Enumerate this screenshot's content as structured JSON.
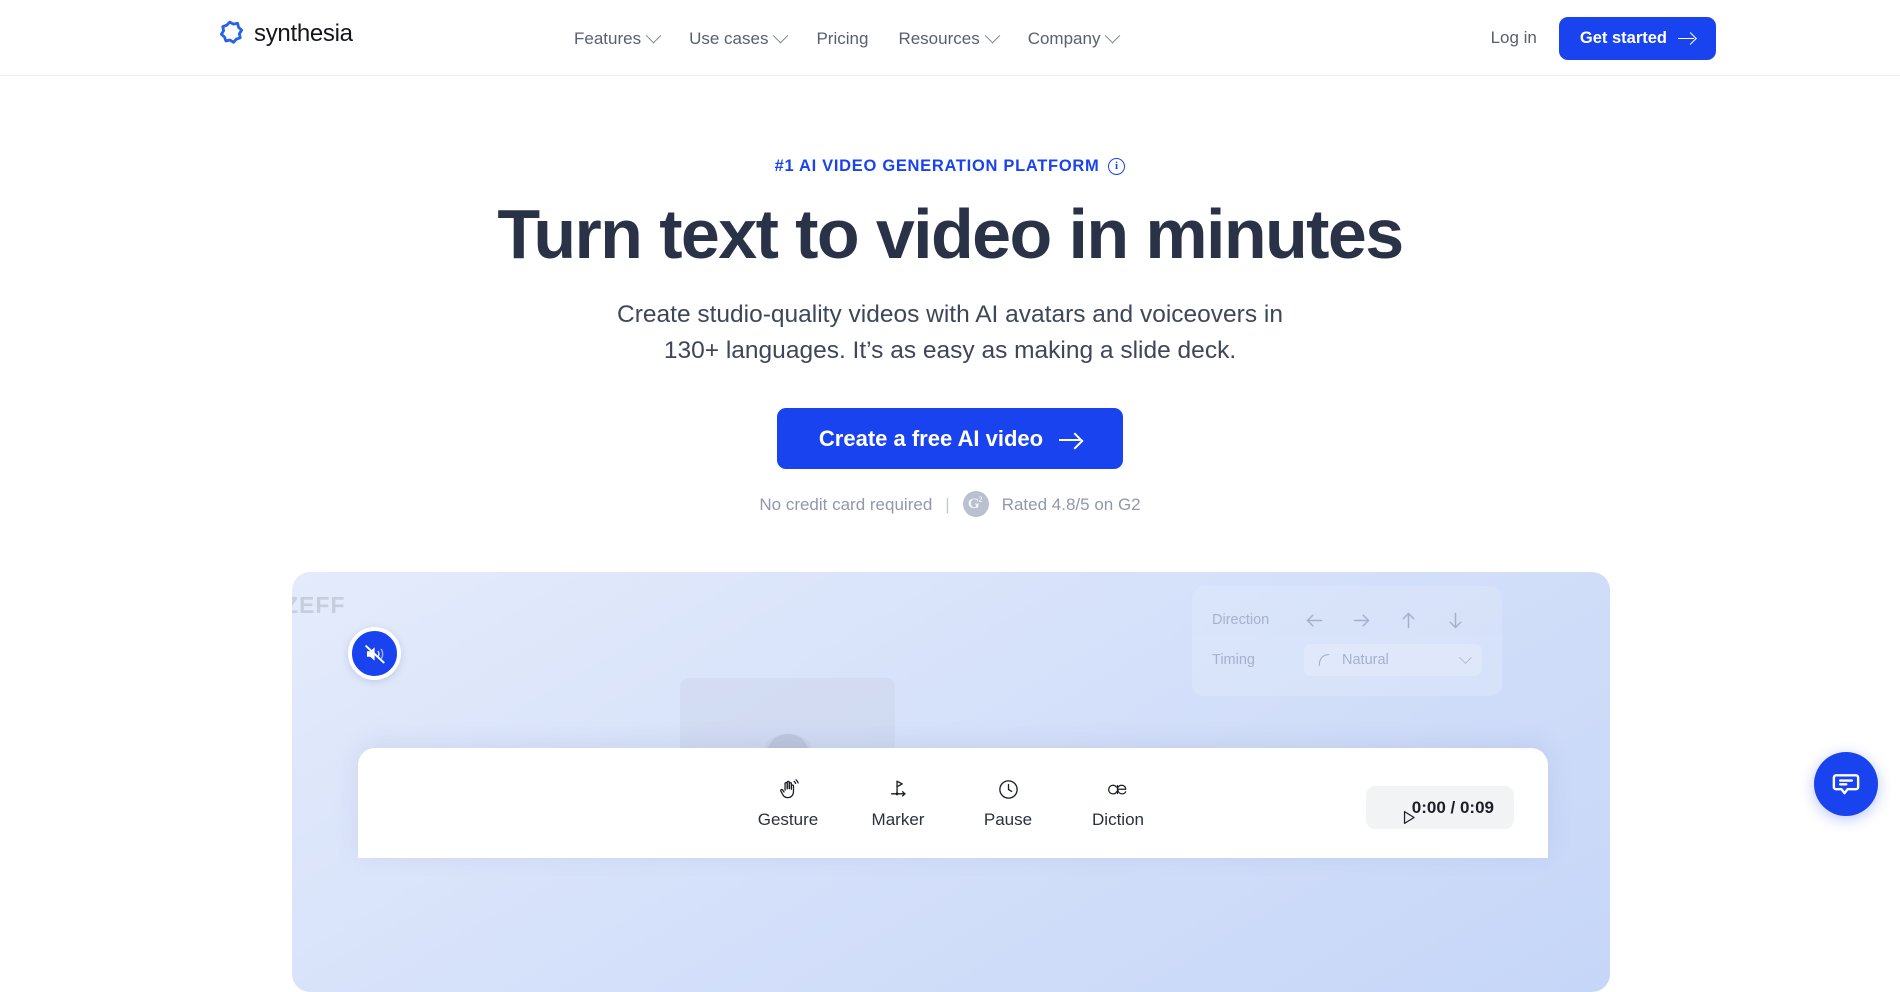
{
  "header": {
    "logo_text": "synthesia",
    "logo_icon": "synthesia-starburst-icon",
    "nav": [
      {
        "label": "Features",
        "has_dropdown": true
      },
      {
        "label": "Use cases",
        "has_dropdown": true
      },
      {
        "label": "Pricing",
        "has_dropdown": false
      },
      {
        "label": "Resources",
        "has_dropdown": true
      },
      {
        "label": "Company",
        "has_dropdown": true
      }
    ],
    "login_label": "Log in",
    "get_started_label": "Get started"
  },
  "hero": {
    "eyebrow": "#1 AI VIDEO GENERATION PLATFORM",
    "eyebrow_info_icon": "info-circle-icon",
    "headline": "Turn text to video in minutes",
    "subhead_line1": "Create studio-quality videos with AI avatars and voiceovers in",
    "subhead_line2": "130+ languages. It’s as easy as making a slide deck.",
    "cta_label": "Create a free AI video",
    "no_credit_card": "No credit card required",
    "separator": "|",
    "g2_mark": "G",
    "g2_sup": "2",
    "rating_text": "Rated 4.8/5 on G2"
  },
  "product": {
    "watermark": "ZEFF",
    "mute_icon": "speaker-muted-icon",
    "avatar_name": "presenter-avatar",
    "settings": {
      "direction_label": "Direction",
      "direction_options": [
        "arrow-left",
        "arrow-right",
        "arrow-up",
        "arrow-down"
      ],
      "timing_label": "Timing",
      "timing_icon": "curve-ease-icon",
      "timing_value": "Natural"
    },
    "toolbar": [
      {
        "label": "Gesture",
        "icon": "waving-hand-icon"
      },
      {
        "label": "Marker",
        "icon": "flag-marker-icon"
      },
      {
        "label": "Pause",
        "icon": "clock-icon"
      },
      {
        "label": "Diction",
        "icon": "ae-ligature-icon"
      }
    ],
    "player": {
      "play_icon": "play-triangle-icon",
      "time": "0:00 / 0:09"
    }
  },
  "chat": {
    "icon": "chat-bubble-icon",
    "label": "Open chat"
  },
  "colors": {
    "brand_blue": "#1A43F0",
    "headline_navy": "#2A3247",
    "body_grey": "#585F73",
    "muted_grey": "#9098AC",
    "card_blue": "#C6D6F8"
  }
}
